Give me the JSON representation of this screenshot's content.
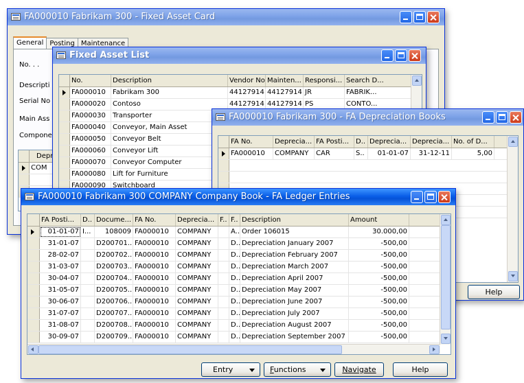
{
  "card": {
    "title": "FA000010 Fabrikam 300 - Fixed Asset Card",
    "tabs": [
      "General",
      "Posting",
      "Maintenance"
    ],
    "field_labels": [
      "No. . .",
      "Descripti",
      "Serial No",
      "Main Ass",
      "Compone"
    ],
    "sub_header": "Depr",
    "sub_row": "COM"
  },
  "fa_list": {
    "title": "Fixed Asset List",
    "columns": [
      "No.",
      "Description",
      "Vendor No.",
      "Mainten...",
      "Responsi...",
      "Search D..."
    ],
    "rows": [
      [
        "FA000010",
        "Fabrikam 300",
        "44127914",
        "44127914",
        "JR",
        "FABRIK..."
      ],
      [
        "FA000020",
        "Contoso",
        "44127914",
        "44127914",
        "PS",
        "CONTO..."
      ],
      [
        "FA000030",
        "Transporter",
        "",
        "",
        "",
        ""
      ],
      [
        "FA000040",
        "Conveyor, Main Asset",
        "",
        "",
        "",
        ""
      ],
      [
        "FA000050",
        "Conveyor Belt",
        "",
        "",
        "",
        ""
      ],
      [
        "FA000060",
        "Conveyor Lift",
        "",
        "",
        "",
        ""
      ],
      [
        "FA000070",
        "Conveyor Computer",
        "",
        "",
        "",
        ""
      ],
      [
        "FA000080",
        "Lift for Furniture",
        "",
        "",
        "",
        ""
      ],
      [
        "FA000090",
        "Switchboard",
        "",
        "",
        "",
        ""
      ]
    ]
  },
  "depr_books": {
    "title": "FA000010 Fabrikam 300 - FA Depreciation Books",
    "columns": [
      "FA No.",
      "Deprecia...",
      "FA Posti...",
      "D..",
      "Deprecia...",
      "Deprecia...",
      "No. of D..."
    ],
    "rows": [
      [
        "FA000010",
        "COMPANY",
        "CAR",
        "S..",
        "01-01-07",
        "31-12-11",
        "5,00"
      ]
    ],
    "help_button": "Help"
  },
  "ledger": {
    "title": "FA000010 Fabrikam 300 COMPANY Company Book - FA Ledger Entries",
    "columns": [
      "FA Posti...",
      "D..",
      "Docume...",
      "FA No.",
      "Deprecia...",
      "F..",
      "F..",
      "Description",
      "Amount"
    ],
    "rows": [
      [
        "01-01-07",
        "I...",
        "108009",
        "FA000010",
        "COMPANY",
        "",
        "A..",
        "Order 106015",
        "30.000,00"
      ],
      [
        "31-01-07",
        "",
        "D200701...",
        "FA000010",
        "COMPANY",
        "",
        "D..",
        "Depreciation January 2007",
        "-500,00"
      ],
      [
        "28-02-07",
        "",
        "D200702...",
        "FA000010",
        "COMPANY",
        "",
        "D..",
        "Depreciation February 2007",
        "-500,00"
      ],
      [
        "31-03-07",
        "",
        "D200703...",
        "FA000010",
        "COMPANY",
        "",
        "D..",
        "Depreciation March 2007",
        "-500,00"
      ],
      [
        "30-04-07",
        "",
        "D200704...",
        "FA000010",
        "COMPANY",
        "",
        "D..",
        "Depreciation April 2007",
        "-500,00"
      ],
      [
        "31-05-07",
        "",
        "D200705...",
        "FA000010",
        "COMPANY",
        "",
        "D..",
        "Depreciation May 2007",
        "-500,00"
      ],
      [
        "30-06-07",
        "",
        "D200706...",
        "FA000010",
        "COMPANY",
        "",
        "D..",
        "Depreciation June 2007",
        "-500,00"
      ],
      [
        "31-07-07",
        "",
        "D200707...",
        "FA000010",
        "COMPANY",
        "",
        "D..",
        "Depreciation July 2007",
        "-500,00"
      ],
      [
        "31-08-07",
        "",
        "D200708...",
        "FA000010",
        "COMPANY",
        "",
        "D..",
        "Depreciation August 2007",
        "-500,00"
      ],
      [
        "30-09-07",
        "",
        "D200709...",
        "FA000010",
        "COMPANY",
        "",
        "D..",
        "Depreciation September 2007",
        "-500,00"
      ]
    ],
    "buttons": {
      "entry": "Entry",
      "functions_u": "F",
      "functions_rest": "unctions",
      "navigate_u": "N",
      "navigate_rest": "avigate",
      "help": "Help"
    }
  },
  "icons": [
    "window-icon",
    "minimize-icon",
    "maximize-icon",
    "close-icon",
    "current-row-icon",
    "dropdown-icon"
  ]
}
